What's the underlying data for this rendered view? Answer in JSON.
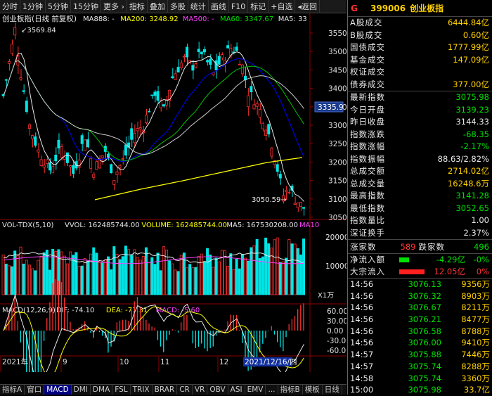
{
  "toolbar": {
    "items": [
      "分时",
      "1分钟",
      "5分钟",
      "15分钟",
      "更多 ›",
      "指标",
      "叠加",
      "多股",
      "统计",
      "画线",
      "F10",
      "标记",
      "+自选",
      "◂返回"
    ]
  },
  "chart": {
    "title": "创业板指(日线 前复权)",
    "ma_labels": [
      {
        "text": "MA888: -",
        "color": "#e8e8e8"
      },
      {
        "text": "MA200: 3248.92",
        "color": "#ffff00"
      },
      {
        "text": "MA500: -",
        "color": "#ff40ff"
      },
      {
        "text": "MA60: 3347.67",
        "color": "#00e000"
      },
      {
        "text": "MA5: 33",
        "color": "#e8e8e8"
      }
    ],
    "price_ticks": [
      "3550",
      "3500",
      "3450",
      "3400",
      "3350",
      "3300",
      "3250",
      "3200",
      "3150",
      "3100",
      "3050"
    ],
    "high_label": "3569.84",
    "low_label": "3050.59",
    "current_price_box": "3335.9",
    "vol_title": "VOL-TDX(5,10)",
    "vol_labels": [
      {
        "text": "VVOL: 162485744.00",
        "color": "#e8e8e8"
      },
      {
        "text": "VOLUME: 162485744.00",
        "color": "#ffff00"
      },
      {
        "text": "MA5: 167530208.00",
        "color": "#e8e8e8"
      },
      {
        "text": "MA10",
        "color": "#ff40ff"
      }
    ],
    "vol_ticks": [
      "20000",
      "10000"
    ],
    "vol_unit": "X1万",
    "macd_title": "MACD(12,26,9)",
    "macd_labels": [
      {
        "text": "DIF: -74.10",
        "color": "#e8e8e8"
      },
      {
        "text": "DEA: -71.31",
        "color": "#ffff00"
      },
      {
        "text": "MACD: -5.60",
        "color": "#ff40ff"
      }
    ],
    "macd_ticks": [
      "60.00",
      "30.00",
      "0.00",
      "-30.00",
      "-60.00"
    ],
    "date_axis": [
      "2021年",
      "9",
      "10",
      "11",
      "12"
    ],
    "date_highlight": "2021/12/16/四"
  },
  "bottom_tabs": [
    "指标A",
    "窗口",
    "MACD",
    "DMI",
    "DMA",
    "FSL",
    "TRIX",
    "BRAR",
    "CR",
    "VR",
    "OBV",
    "ASI",
    "EMV",
    "...",
    "指标B",
    "模板",
    "日线"
  ],
  "active_tab": "MACD",
  "quote": {
    "marker": "G",
    "code": "399006",
    "name": "创业板指",
    "volumes": [
      {
        "label": "A股成交",
        "value": "6444.84亿"
      },
      {
        "label": "B股成交",
        "value": "0.60亿"
      },
      {
        "label": "国债成交",
        "value": "1777.99亿"
      },
      {
        "label": "基金成交",
        "value": "147.09亿"
      },
      {
        "label": "权证成交",
        "value": ""
      },
      {
        "label": "债券成交",
        "value": "377.00亿"
      }
    ],
    "stats": [
      {
        "label": "最新指数",
        "value": "3075.98",
        "color": "#00e000"
      },
      {
        "label": "今日开盘",
        "value": "3139.23",
        "color": "#00e000"
      },
      {
        "label": "昨日收盘",
        "value": "3144.33",
        "color": "#e8e8e8"
      },
      {
        "label": "指数涨跌",
        "value": "-68.35",
        "color": "#00e000"
      },
      {
        "label": "指数涨幅",
        "value": "-2.17%",
        "color": "#00e000"
      },
      {
        "label": "指数振幅",
        "value": "88.63/2.82%",
        "color": "#e8e8e8"
      },
      {
        "label": "总成交额",
        "value": "2714.02亿",
        "color": "#ffd000"
      },
      {
        "label": "总成交量",
        "value": "16248.6万",
        "color": "#ffd000"
      },
      {
        "label": "最高指数",
        "value": "3141.28",
        "color": "#00e000"
      },
      {
        "label": "最低指数",
        "value": "3052.65",
        "color": "#00e000"
      },
      {
        "label": "指数量比",
        "value": "1.00",
        "color": "#e8e8e8"
      },
      {
        "label": "深证换手",
        "value": "2.37%",
        "color": "#e8e8e8"
      }
    ],
    "up_label": "涨家数",
    "up_count": "589",
    "down_label": "跌家数",
    "down_count": "496",
    "flows": [
      {
        "label": "净流入额",
        "value": "-4.29亿",
        "pct": "-0%",
        "bar_color": "#00e000",
        "bar_width": 14,
        "val_color": "#00e000"
      },
      {
        "label": "大宗流入",
        "value": "12.05亿",
        "pct": "0%",
        "bar_color": "#ff2020",
        "bar_width": 36,
        "val_color": "#ff3333"
      }
    ],
    "ticks": [
      {
        "time": "14:56",
        "price": "3076.13",
        "vol": "9356万"
      },
      {
        "time": "14:56",
        "price": "3076.32",
        "vol": "8903万"
      },
      {
        "time": "14:56",
        "price": "3076.67",
        "vol": "8211万"
      },
      {
        "time": "14:56",
        "price": "3076.21",
        "vol": "8477万"
      },
      {
        "time": "14:56",
        "price": "3076.58",
        "vol": "8788万"
      },
      {
        "time": "14:56",
        "price": "3076.00",
        "vol": "9410万"
      },
      {
        "time": "14:57",
        "price": "3075.88",
        "vol": "7446万"
      },
      {
        "time": "14:57",
        "price": "3075.74",
        "vol": "8288万"
      },
      {
        "time": "14:58",
        "price": "3075.74",
        "vol": "3360万"
      },
      {
        "time": "15:00",
        "price": "3075.98",
        "vol": "33.7亿"
      }
    ]
  }
}
